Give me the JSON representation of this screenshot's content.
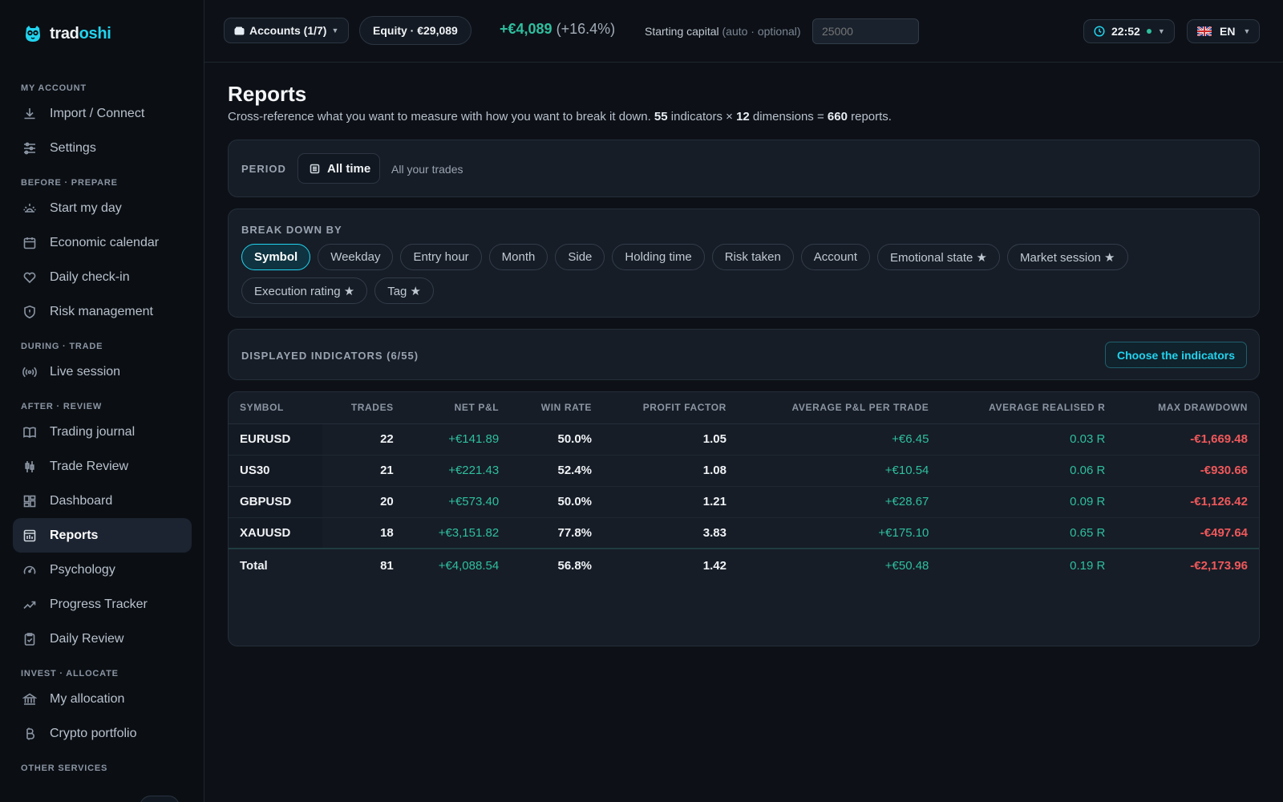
{
  "brand": {
    "name_part1": "trad",
    "name_part2": "oshi"
  },
  "sidebar": {
    "sections": [
      {
        "title": "MY ACCOUNT",
        "items": [
          {
            "label": "Import / Connect",
            "icon": "download-icon"
          },
          {
            "label": "Settings",
            "icon": "sliders-icon"
          }
        ]
      },
      {
        "title": "BEFORE · PREPARE",
        "items": [
          {
            "label": "Start my day",
            "icon": "sunrise-icon"
          },
          {
            "label": "Economic calendar",
            "icon": "calendar-icon"
          },
          {
            "label": "Daily check-in",
            "icon": "heart-icon"
          },
          {
            "label": "Risk management",
            "icon": "shield-icon"
          }
        ]
      },
      {
        "title": "DURING · TRADE",
        "items": [
          {
            "label": "Live session",
            "icon": "broadcast-icon"
          }
        ]
      },
      {
        "title": "AFTER · REVIEW",
        "items": [
          {
            "label": "Trading journal",
            "icon": "book-icon"
          },
          {
            "label": "Trade Review",
            "icon": "candles-icon"
          },
          {
            "label": "Dashboard",
            "icon": "grid-icon"
          },
          {
            "label": "Reports",
            "icon": "report-icon",
            "active": true
          },
          {
            "label": "Psychology",
            "icon": "gauge-icon"
          },
          {
            "label": "Progress Tracker",
            "icon": "trending-up-icon"
          },
          {
            "label": "Daily Review",
            "icon": "clipboard-check-icon"
          }
        ]
      },
      {
        "title": "INVEST · ALLOCATE",
        "items": [
          {
            "label": "My allocation",
            "icon": "bank-icon"
          },
          {
            "label": "Crypto portfolio",
            "icon": "bitcoin-icon"
          }
        ]
      },
      {
        "title": "OTHER SERVICES",
        "items": []
      }
    ]
  },
  "topbar": {
    "accounts_label": "Accounts (1/7)",
    "equity_label": "Equity · €29,089",
    "equity_change": "+€4,089",
    "equity_change_pct": "(+16.4%)",
    "capital_label": "Starting capital",
    "capital_hint": "(auto · optional)",
    "capital_placeholder": "25000",
    "clock": "22:52",
    "language": "EN"
  },
  "page": {
    "title": "Reports",
    "subtitle_pre": "Cross-reference what you want to measure with how you want to break it down. ",
    "indicators_count": "55",
    "subtitle_mid1": " indicators × ",
    "dimensions_count": "12",
    "subtitle_mid2": " dimensions = ",
    "reports_count": "660",
    "subtitle_post": " reports."
  },
  "period": {
    "label": "PERIOD",
    "button": "All time",
    "description": "All your trades"
  },
  "breakdown": {
    "label": "BREAK DOWN BY",
    "options": [
      {
        "label": "Symbol",
        "active": true
      },
      {
        "label": "Weekday"
      },
      {
        "label": "Entry hour"
      },
      {
        "label": "Month"
      },
      {
        "label": "Side"
      },
      {
        "label": "Holding time"
      },
      {
        "label": "Risk taken"
      },
      {
        "label": "Account"
      },
      {
        "label": "Emotional state ★"
      },
      {
        "label": "Market session ★"
      },
      {
        "label": "Execution rating ★"
      },
      {
        "label": "Tag ★"
      }
    ]
  },
  "indicators": {
    "label": "DISPLAYED INDICATORS (6/55)",
    "choose_button": "Choose the indicators"
  },
  "table": {
    "columns": [
      "SYMBOL",
      "TRADES",
      "NET P&L",
      "WIN RATE",
      "PROFIT FACTOR",
      "AVERAGE P&L PER TRADE",
      "AVERAGE REALISED R",
      "MAX DRAWDOWN"
    ],
    "rows": [
      [
        "EURUSD",
        "22",
        "+€141.89",
        "50.0%",
        "1.05",
        "+€6.45",
        "0.03 R",
        "-€1,669.48"
      ],
      [
        "US30",
        "21",
        "+€221.43",
        "52.4%",
        "1.08",
        "+€10.54",
        "0.06 R",
        "-€930.66"
      ],
      [
        "GBPUSD",
        "20",
        "+€573.40",
        "50.0%",
        "1.21",
        "+€28.67",
        "0.09 R",
        "-€1,126.42"
      ],
      [
        "XAUUSD",
        "18",
        "+€3,151.82",
        "77.8%",
        "3.83",
        "+€175.10",
        "0.65 R",
        "-€497.64"
      ]
    ],
    "total": [
      "Total",
      "81",
      "+€4,088.54",
      "56.8%",
      "1.42",
      "+€50.48",
      "0.19 R",
      "-€2,173.96"
    ]
  },
  "colors": {
    "accent": "#22d3ee",
    "positive": "#2fbf9f",
    "negative": "#f0585a"
  }
}
